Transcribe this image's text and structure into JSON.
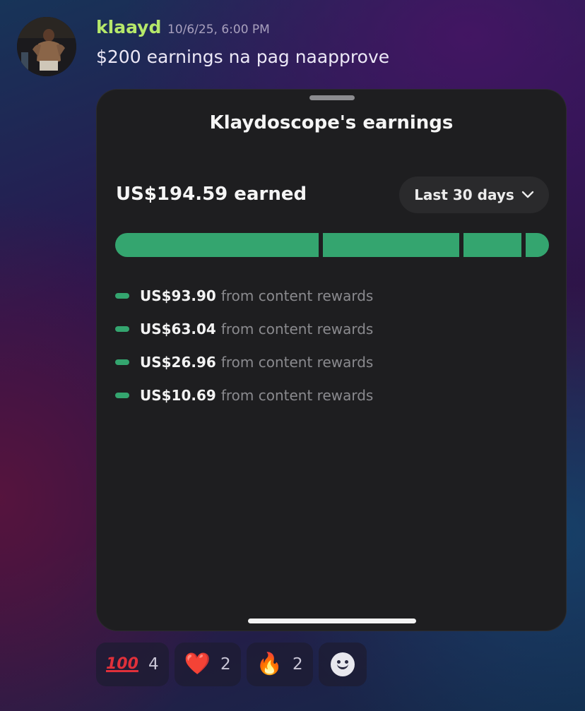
{
  "message": {
    "author": "klaayd",
    "timestamp": "10/6/25, 6:00 PM",
    "text": "$200 earnings na pag naapprove",
    "avatar": "avatar"
  },
  "card": {
    "title": "Klaydoscope's earnings",
    "earned_label": "US$194.59 earned",
    "period_selector": {
      "value": "Last 30 days",
      "icon": "chevron-down-icon"
    },
    "bar_color": "#34a56f",
    "breakdown": [
      {
        "amount": "US$93.90",
        "source": "from content rewards",
        "value": 93.9
      },
      {
        "amount": "US$63.04",
        "source": "from content rewards",
        "value": 63.04
      },
      {
        "amount": "US$26.96",
        "source": "from content rewards",
        "value": 26.96
      },
      {
        "amount": "US$10.69",
        "source": "from content rewards",
        "value": 10.69
      }
    ]
  },
  "reactions": [
    {
      "emoji": "💯",
      "icon": "hundred-points-icon",
      "count": "4"
    },
    {
      "emoji": "❤️",
      "icon": "heart-icon",
      "count": "2"
    },
    {
      "emoji": "🔥",
      "icon": "fire-icon",
      "count": "2"
    }
  ],
  "add_reaction": {
    "icon": "add-reaction-icon"
  },
  "colors": {
    "username": "#b6e86a",
    "card_background": "#1e1e20",
    "accent_green": "#34a56f"
  }
}
